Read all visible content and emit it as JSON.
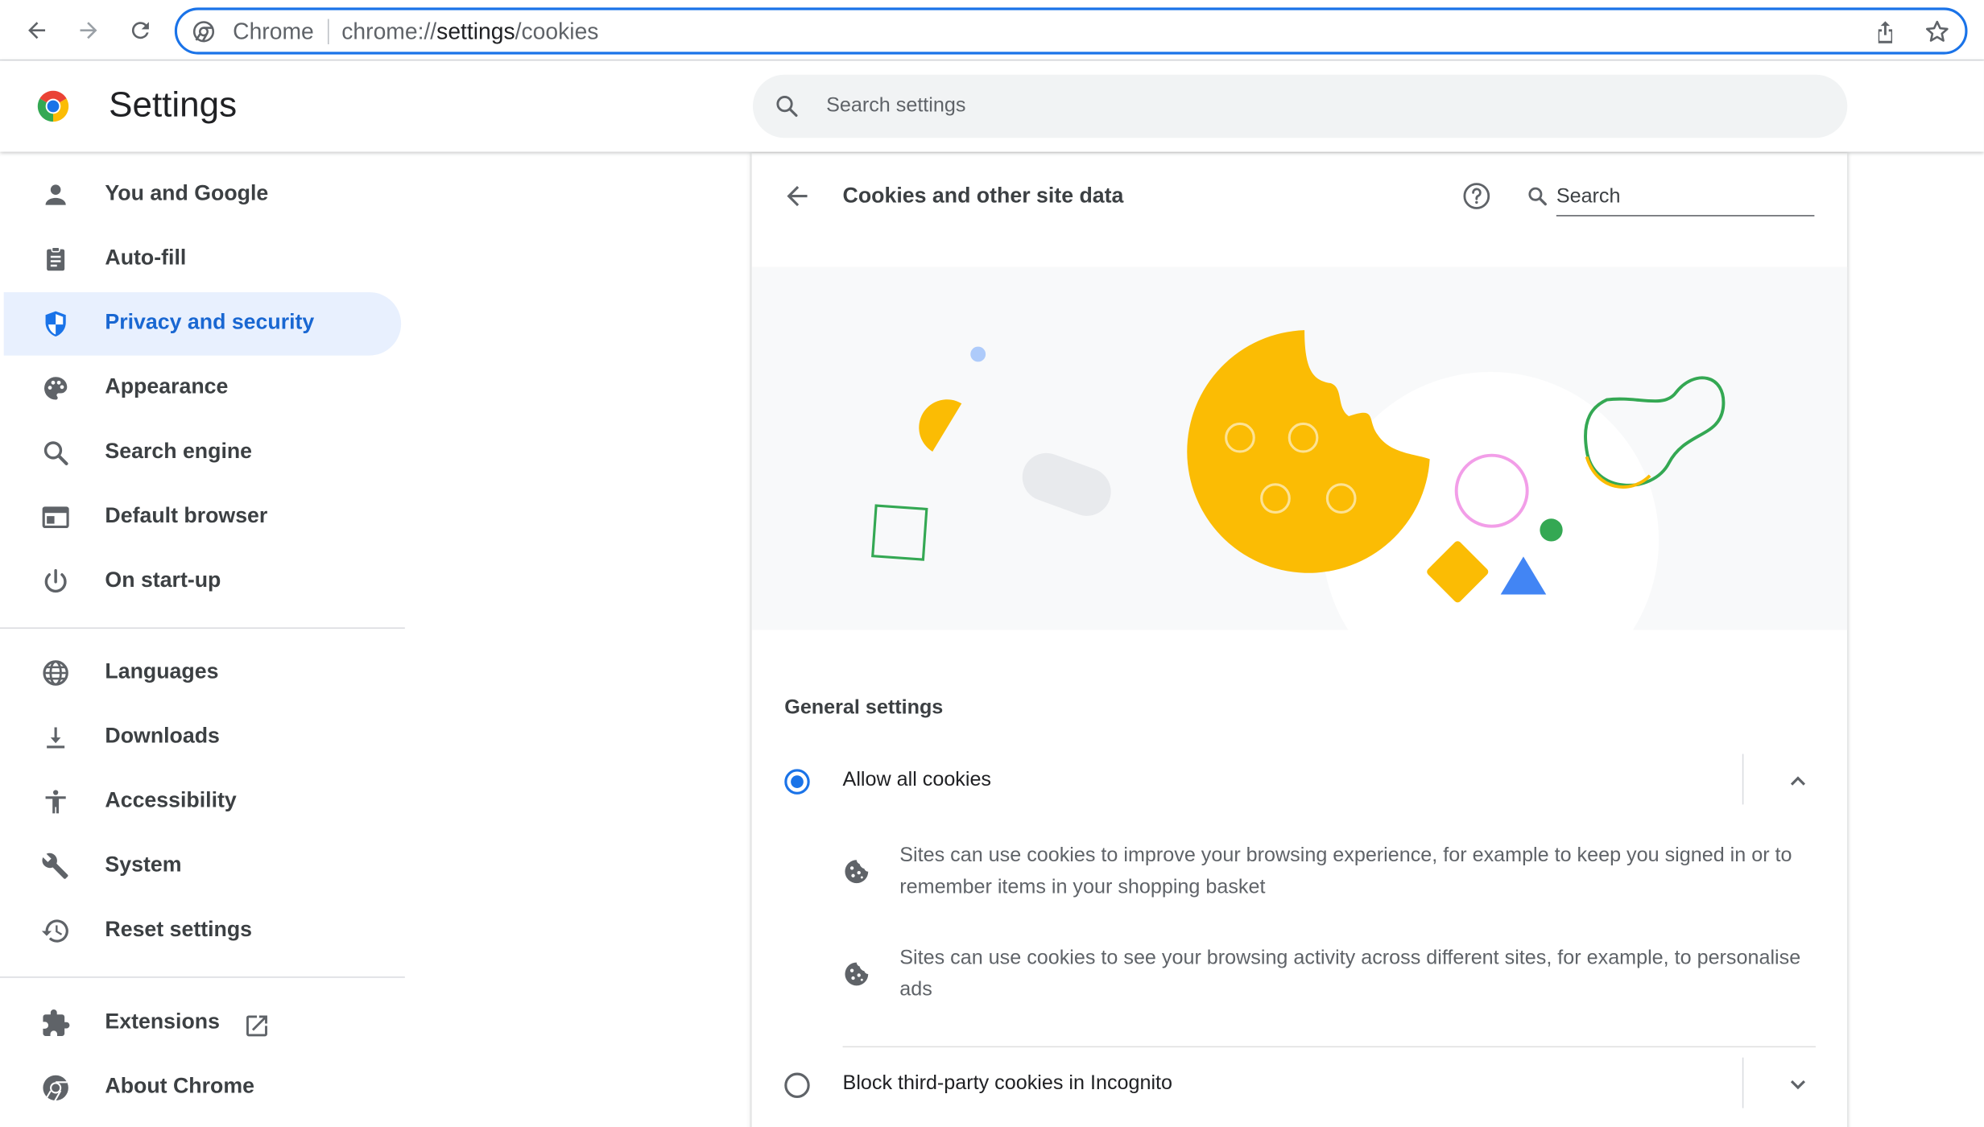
{
  "browser": {
    "chip_label": "Chrome",
    "url_scheme": "chrome://",
    "url_host": "settings",
    "url_path": "/cookies"
  },
  "header": {
    "title": "Settings",
    "search_placeholder": "Search settings"
  },
  "sidebar": {
    "items": [
      {
        "label": "You and Google",
        "icon": "person-icon"
      },
      {
        "label": "Auto-fill",
        "icon": "clipboard-icon"
      },
      {
        "label": "Privacy and security",
        "icon": "shield-icon",
        "active": true
      },
      {
        "label": "Appearance",
        "icon": "palette-icon"
      },
      {
        "label": "Search engine",
        "icon": "search-icon"
      },
      {
        "label": "Default browser",
        "icon": "browser-window-icon"
      },
      {
        "label": "On start-up",
        "icon": "power-icon"
      },
      {
        "label": "Languages",
        "icon": "globe-icon"
      },
      {
        "label": "Downloads",
        "icon": "download-icon"
      },
      {
        "label": "Accessibility",
        "icon": "accessibility-icon"
      },
      {
        "label": "System",
        "icon": "wrench-icon"
      },
      {
        "label": "Reset settings",
        "icon": "history-icon"
      },
      {
        "label": "Extensions",
        "icon": "puzzle-icon"
      },
      {
        "label": "About Chrome",
        "icon": "chrome-icon"
      }
    ]
  },
  "page": {
    "title": "Cookies and other site data",
    "search_placeholder": "Search",
    "section_title": "General settings",
    "options": [
      {
        "label": "Allow all cookies",
        "selected": true,
        "expanded": true,
        "details": [
          "Sites can use cookies to improve your browsing experience, for example to keep you signed in or to remember items in your shopping basket",
          "Sites can use cookies to see your browsing activity across different sites, for example, to personalise ads"
        ]
      },
      {
        "label": "Block third-party cookies in Incognito",
        "selected": false,
        "expanded": false
      }
    ]
  },
  "colors": {
    "accent": "#1a73e8",
    "active_nav_bg": "#e8f0fe",
    "active_nav_text": "#1967d2",
    "cookie_yellow": "#fbbc04",
    "hero_bg": "#f8f9fa"
  }
}
